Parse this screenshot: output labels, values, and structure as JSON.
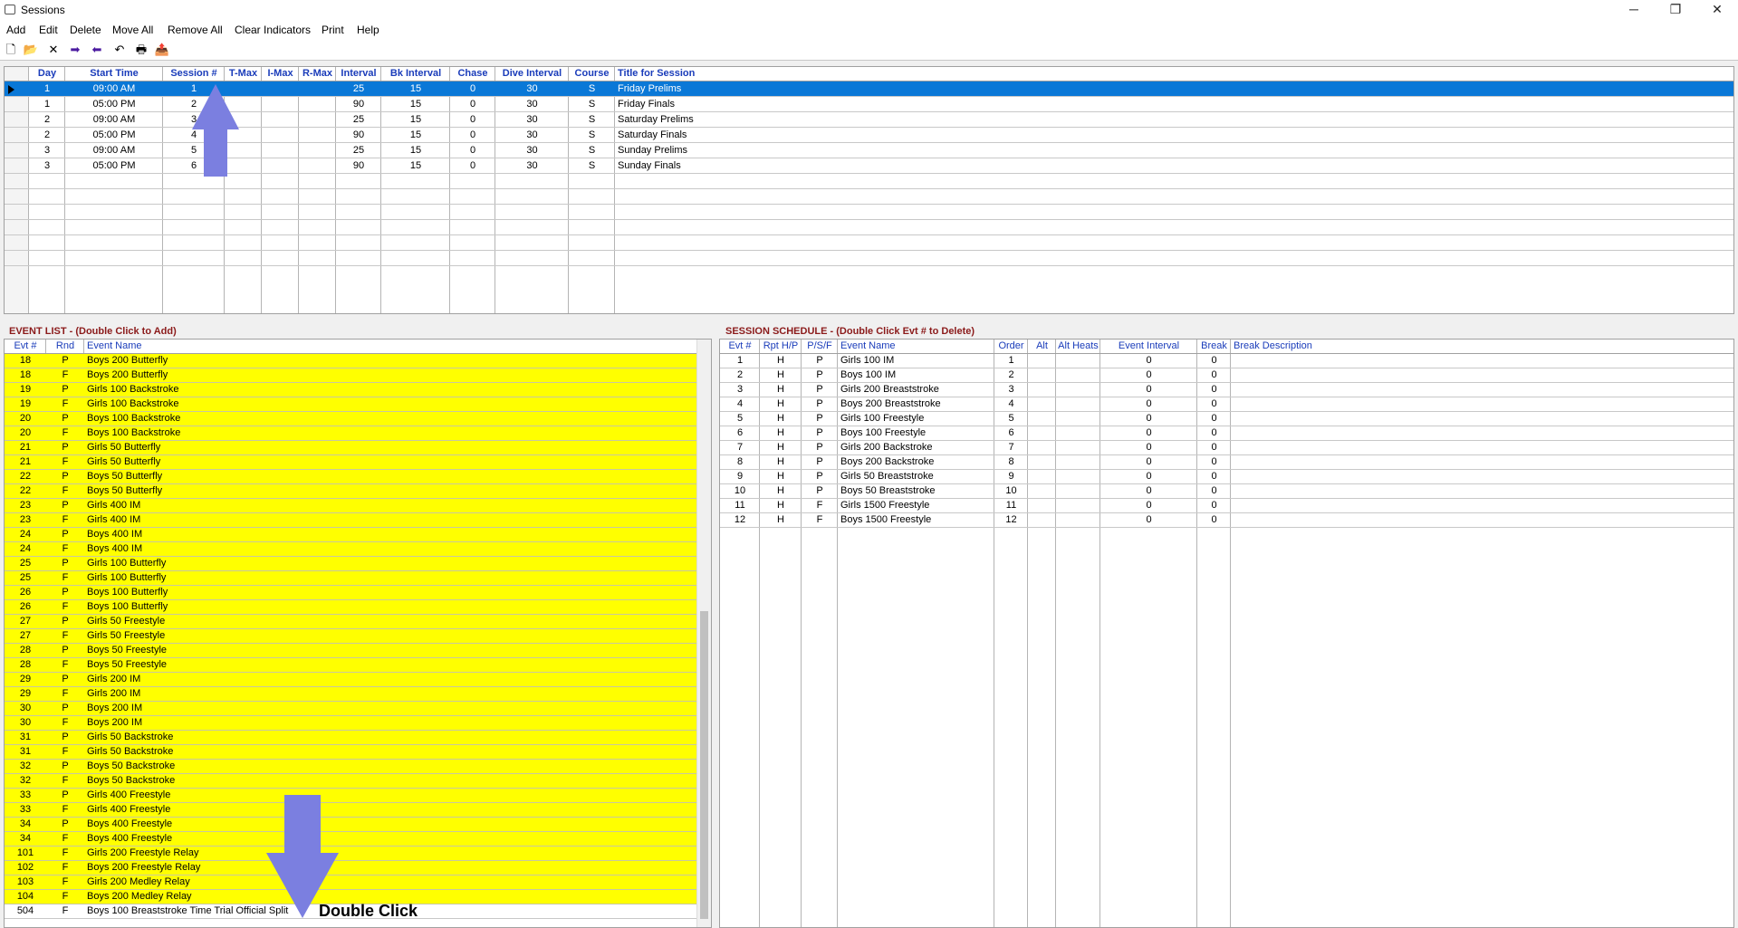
{
  "window": {
    "title": "Sessions",
    "controls": [
      "─",
      "❐",
      "✕"
    ]
  },
  "menu": [
    "Add",
    "Edit",
    "Delete",
    "Move All",
    "Remove All",
    "Clear Indicators",
    "Print",
    "Help"
  ],
  "toolbar": [
    "🗋",
    "📂",
    "✕",
    "➡",
    "⬅",
    "↶",
    "🖶",
    "📤"
  ],
  "sessions": {
    "columns": [
      "Day",
      "Start Time",
      "Session #",
      "T-Max",
      "I-Max",
      "R-Max",
      "Interval",
      "Bk Interval",
      "Chase",
      "Dive Interval",
      "Course",
      "Title for Session"
    ],
    "rows": [
      [
        "1",
        "09:00 AM",
        "1",
        "",
        "",
        "",
        "25",
        "15",
        "0",
        "30",
        "S",
        "Friday Prelims"
      ],
      [
        "1",
        "05:00 PM",
        "2",
        "",
        "",
        "",
        "90",
        "15",
        "0",
        "30",
        "S",
        "Friday Finals"
      ],
      [
        "2",
        "09:00 AM",
        "3",
        "",
        "",
        "",
        "25",
        "15",
        "0",
        "30",
        "S",
        "Saturday Prelims"
      ],
      [
        "2",
        "05:00 PM",
        "4",
        "",
        "",
        "",
        "90",
        "15",
        "0",
        "30",
        "S",
        "Saturday Finals"
      ],
      [
        "3",
        "09:00 AM",
        "5",
        "",
        "",
        "",
        "25",
        "15",
        "0",
        "30",
        "S",
        "Sunday Prelims"
      ],
      [
        "3",
        "05:00 PM",
        "6",
        "",
        "",
        "",
        "90",
        "15",
        "0",
        "30",
        "S",
        "Sunday Finals"
      ]
    ]
  },
  "event_list": {
    "title": "EVENT LIST - (Double Click to Add)",
    "columns": [
      "Evt #",
      "Rnd",
      "Event Name"
    ],
    "rows": [
      [
        "18",
        "P",
        "Boys 200 Butterfly"
      ],
      [
        "18",
        "F",
        "Boys 200 Butterfly"
      ],
      [
        "19",
        "P",
        "Girls 100 Backstroke"
      ],
      [
        "19",
        "F",
        "Girls 100 Backstroke"
      ],
      [
        "20",
        "P",
        "Boys 100 Backstroke"
      ],
      [
        "20",
        "F",
        "Boys 100 Backstroke"
      ],
      [
        "21",
        "P",
        "Girls 50 Butterfly"
      ],
      [
        "21",
        "F",
        "Girls 50 Butterfly"
      ],
      [
        "22",
        "P",
        "Boys 50 Butterfly"
      ],
      [
        "22",
        "F",
        "Boys 50 Butterfly"
      ],
      [
        "23",
        "P",
        "Girls 400 IM"
      ],
      [
        "23",
        "F",
        "Girls 400 IM"
      ],
      [
        "24",
        "P",
        "Boys 400 IM"
      ],
      [
        "24",
        "F",
        "Boys 400 IM"
      ],
      [
        "25",
        "P",
        "Girls 100 Butterfly"
      ],
      [
        "25",
        "F",
        "Girls 100 Butterfly"
      ],
      [
        "26",
        "P",
        "Boys 100 Butterfly"
      ],
      [
        "26",
        "F",
        "Boys 100 Butterfly"
      ],
      [
        "27",
        "P",
        "Girls 50 Freestyle"
      ],
      [
        "27",
        "F",
        "Girls 50 Freestyle"
      ],
      [
        "28",
        "P",
        "Boys 50 Freestyle"
      ],
      [
        "28",
        "F",
        "Boys 50 Freestyle"
      ],
      [
        "29",
        "P",
        "Girls 200 IM"
      ],
      [
        "29",
        "F",
        "Girls 200 IM"
      ],
      [
        "30",
        "P",
        "Boys 200 IM"
      ],
      [
        "30",
        "F",
        "Boys 200 IM"
      ],
      [
        "31",
        "P",
        "Girls 50 Backstroke"
      ],
      [
        "31",
        "F",
        "Girls 50 Backstroke"
      ],
      [
        "32",
        "P",
        "Boys 50 Backstroke"
      ],
      [
        "32",
        "F",
        "Boys 50 Backstroke"
      ],
      [
        "33",
        "P",
        "Girls 400 Freestyle"
      ],
      [
        "33",
        "F",
        "Girls 400 Freestyle"
      ],
      [
        "34",
        "P",
        "Boys 400 Freestyle"
      ],
      [
        "34",
        "F",
        "Boys 400 Freestyle"
      ],
      [
        "101",
        "F",
        "Girls 200 Freestyle Relay"
      ],
      [
        "102",
        "F",
        "Boys 200 Freestyle Relay"
      ],
      [
        "103",
        "F",
        "Girls 200 Medley Relay"
      ],
      [
        "104",
        "F",
        "Boys 200 Medley Relay"
      ],
      [
        "504",
        "F",
        "Boys 100 Breaststroke Time Trial Official Split"
      ]
    ],
    "highlight_color": "#ffff00",
    "highlighted_row_count": 38
  },
  "schedule": {
    "title": "SESSION SCHEDULE - (Double Click Evt # to Delete)",
    "columns": [
      "Evt #",
      "Rpt H/P",
      "P/S/F",
      "Event Name",
      "Order",
      "Alt",
      "Alt Heats",
      "Event Interval",
      "Break",
      "Break Description"
    ],
    "rows": [
      [
        "1",
        "H",
        "P",
        "Girls 100 IM",
        "1",
        "",
        "",
        "0",
        "0",
        ""
      ],
      [
        "2",
        "H",
        "P",
        "Boys 100 IM",
        "2",
        "",
        "",
        "0",
        "0",
        ""
      ],
      [
        "3",
        "H",
        "P",
        "Girls 200 Breaststroke",
        "3",
        "",
        "",
        "0",
        "0",
        ""
      ],
      [
        "4",
        "H",
        "P",
        "Boys 200 Breaststroke",
        "4",
        "",
        "",
        "0",
        "0",
        ""
      ],
      [
        "5",
        "H",
        "P",
        "Girls 100 Freestyle",
        "5",
        "",
        "",
        "0",
        "0",
        ""
      ],
      [
        "6",
        "H",
        "P",
        "Boys 100 Freestyle",
        "6",
        "",
        "",
        "0",
        "0",
        ""
      ],
      [
        "7",
        "H",
        "P",
        "Girls 200 Backstroke",
        "7",
        "",
        "",
        "0",
        "0",
        ""
      ],
      [
        "8",
        "H",
        "P",
        "Boys 200 Backstroke",
        "8",
        "",
        "",
        "0",
        "0",
        ""
      ],
      [
        "9",
        "H",
        "P",
        "Girls 50 Breaststroke",
        "9",
        "",
        "",
        "0",
        "0",
        ""
      ],
      [
        "10",
        "H",
        "P",
        "Boys 50 Breaststroke",
        "10",
        "",
        "",
        "0",
        "0",
        ""
      ],
      [
        "11",
        "H",
        "F",
        "Girls 1500 Freestyle",
        "11",
        "",
        "",
        "0",
        "0",
        ""
      ],
      [
        "12",
        "H",
        "F",
        "Boys 1500 Freestyle",
        "12",
        "",
        "",
        "0",
        "0",
        ""
      ]
    ]
  },
  "annotation": {
    "text": "Double Click",
    "arrow_color": "#7b7fe0"
  },
  "colors": {
    "selected_row": "#0a78d7",
    "header_text": "#1a3cba",
    "panel_title": "#8b1a1a"
  }
}
